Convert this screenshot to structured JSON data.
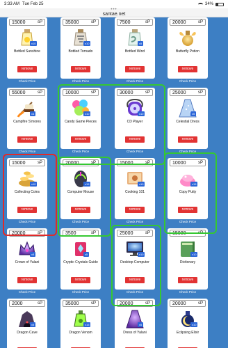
{
  "status_bar": {
    "time": "3:33 AM",
    "date": "Tue Feb 25",
    "battery": "34%"
  },
  "browser": {
    "url": "santae.net",
    "menu_dots": "•••"
  },
  "labels": {
    "currency": "sP",
    "remove": "remove",
    "check_price": "Check Price"
  },
  "items": [
    {
      "name": "Bottled Sunshine",
      "price": "15000",
      "qty": "x10",
      "icon": "bottle-sunshine-icon"
    },
    {
      "name": "Bottled Tornado",
      "price": "35000",
      "qty": "x10",
      "icon": "bottle-tornado-icon"
    },
    {
      "name": "Bottled Wind",
      "price": "7500",
      "qty": "x5",
      "icon": "bottle-wind-icon"
    },
    {
      "name": "Butterfly Potion",
      "price": "20000",
      "qty": "",
      "icon": "butterfly-potion-icon"
    },
    {
      "name": "Campfire S'mores",
      "price": "55000",
      "qty": "x4",
      "icon": "smores-icon"
    },
    {
      "name": "Candy Game Pieces",
      "price": "10000",
      "qty": "x10",
      "icon": "candy-pieces-icon"
    },
    {
      "name": "CD Player",
      "price": "30000",
      "qty": "x10",
      "icon": "cd-player-icon"
    },
    {
      "name": "Celestial Dress",
      "price": "25000",
      "qty": "x5",
      "icon": "celestial-dress-icon"
    },
    {
      "name": "Collecting Coins",
      "price": "15000",
      "qty": "x10",
      "icon": "coins-icon"
    },
    {
      "name": "Computer Mouse",
      "price": "20000",
      "qty": "x15",
      "icon": "computer-mouse-icon"
    },
    {
      "name": "Cooking 101",
      "price": "15000",
      "qty": "x10",
      "icon": "cookbook-icon"
    },
    {
      "name": "Copy Putty",
      "price": "10000",
      "qty": "x15",
      "icon": "putty-icon"
    },
    {
      "name": "Crown of Yalani",
      "price": "20000",
      "qty": "x5",
      "icon": "crown-icon"
    },
    {
      "name": "Cryptic Crystals Guide",
      "price": "3500",
      "qty": "x5",
      "icon": "crystals-guide-icon"
    },
    {
      "name": "Desktop Computer",
      "price": "25000",
      "qty": "x10",
      "icon": "desktop-computer-icon"
    },
    {
      "name": "Dictionary",
      "price": "15000",
      "qty": "x10",
      "icon": "dictionary-icon"
    },
    {
      "name": "Dragon Cave",
      "price": "2000",
      "qty": "x5",
      "icon": "dragon-cave-icon"
    },
    {
      "name": "Dragon Venom",
      "price": "35000",
      "qty": "x15",
      "icon": "dragon-venom-icon"
    },
    {
      "name": "Dress of Yalani",
      "price": "20000",
      "qty": "x5",
      "icon": "dress-icon"
    },
    {
      "name": "Eclipsing Elixir",
      "price": "20000",
      "qty": "x10",
      "icon": "elixir-icon"
    }
  ],
  "colors": {
    "background": "#3d7fc4",
    "remove": "#e23333",
    "badge": "#2b66d8",
    "highlight_green": "#35c832",
    "highlight_red": "#e02a2a"
  }
}
